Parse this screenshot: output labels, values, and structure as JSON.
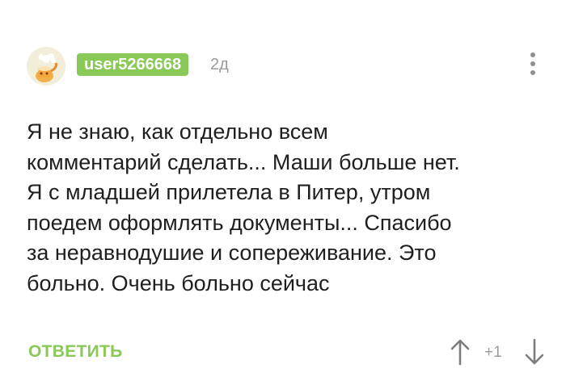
{
  "comment": {
    "author": "user5266668",
    "time": "2д",
    "avatar_icon": "teapot-avatar-icon",
    "menu_icon": "more-vertical-icon",
    "text_lines": [
      "Я не знаю, как отдельно всем",
      "комментарий сделать... Маши больше нет.",
      "Я с младшей прилетела в Питер, утром",
      "поедем оформлять документы... Спасибо",
      "за неравнодушие и сопереживание. Это",
      "больно. Очень больно сейчас"
    ],
    "reply_label": "ОТВЕТИТЬ",
    "rating": "+1"
  },
  "colors": {
    "accent_green": "#8ac858",
    "muted_gray": "#9b9b9b",
    "text": "#1f1f1f"
  }
}
